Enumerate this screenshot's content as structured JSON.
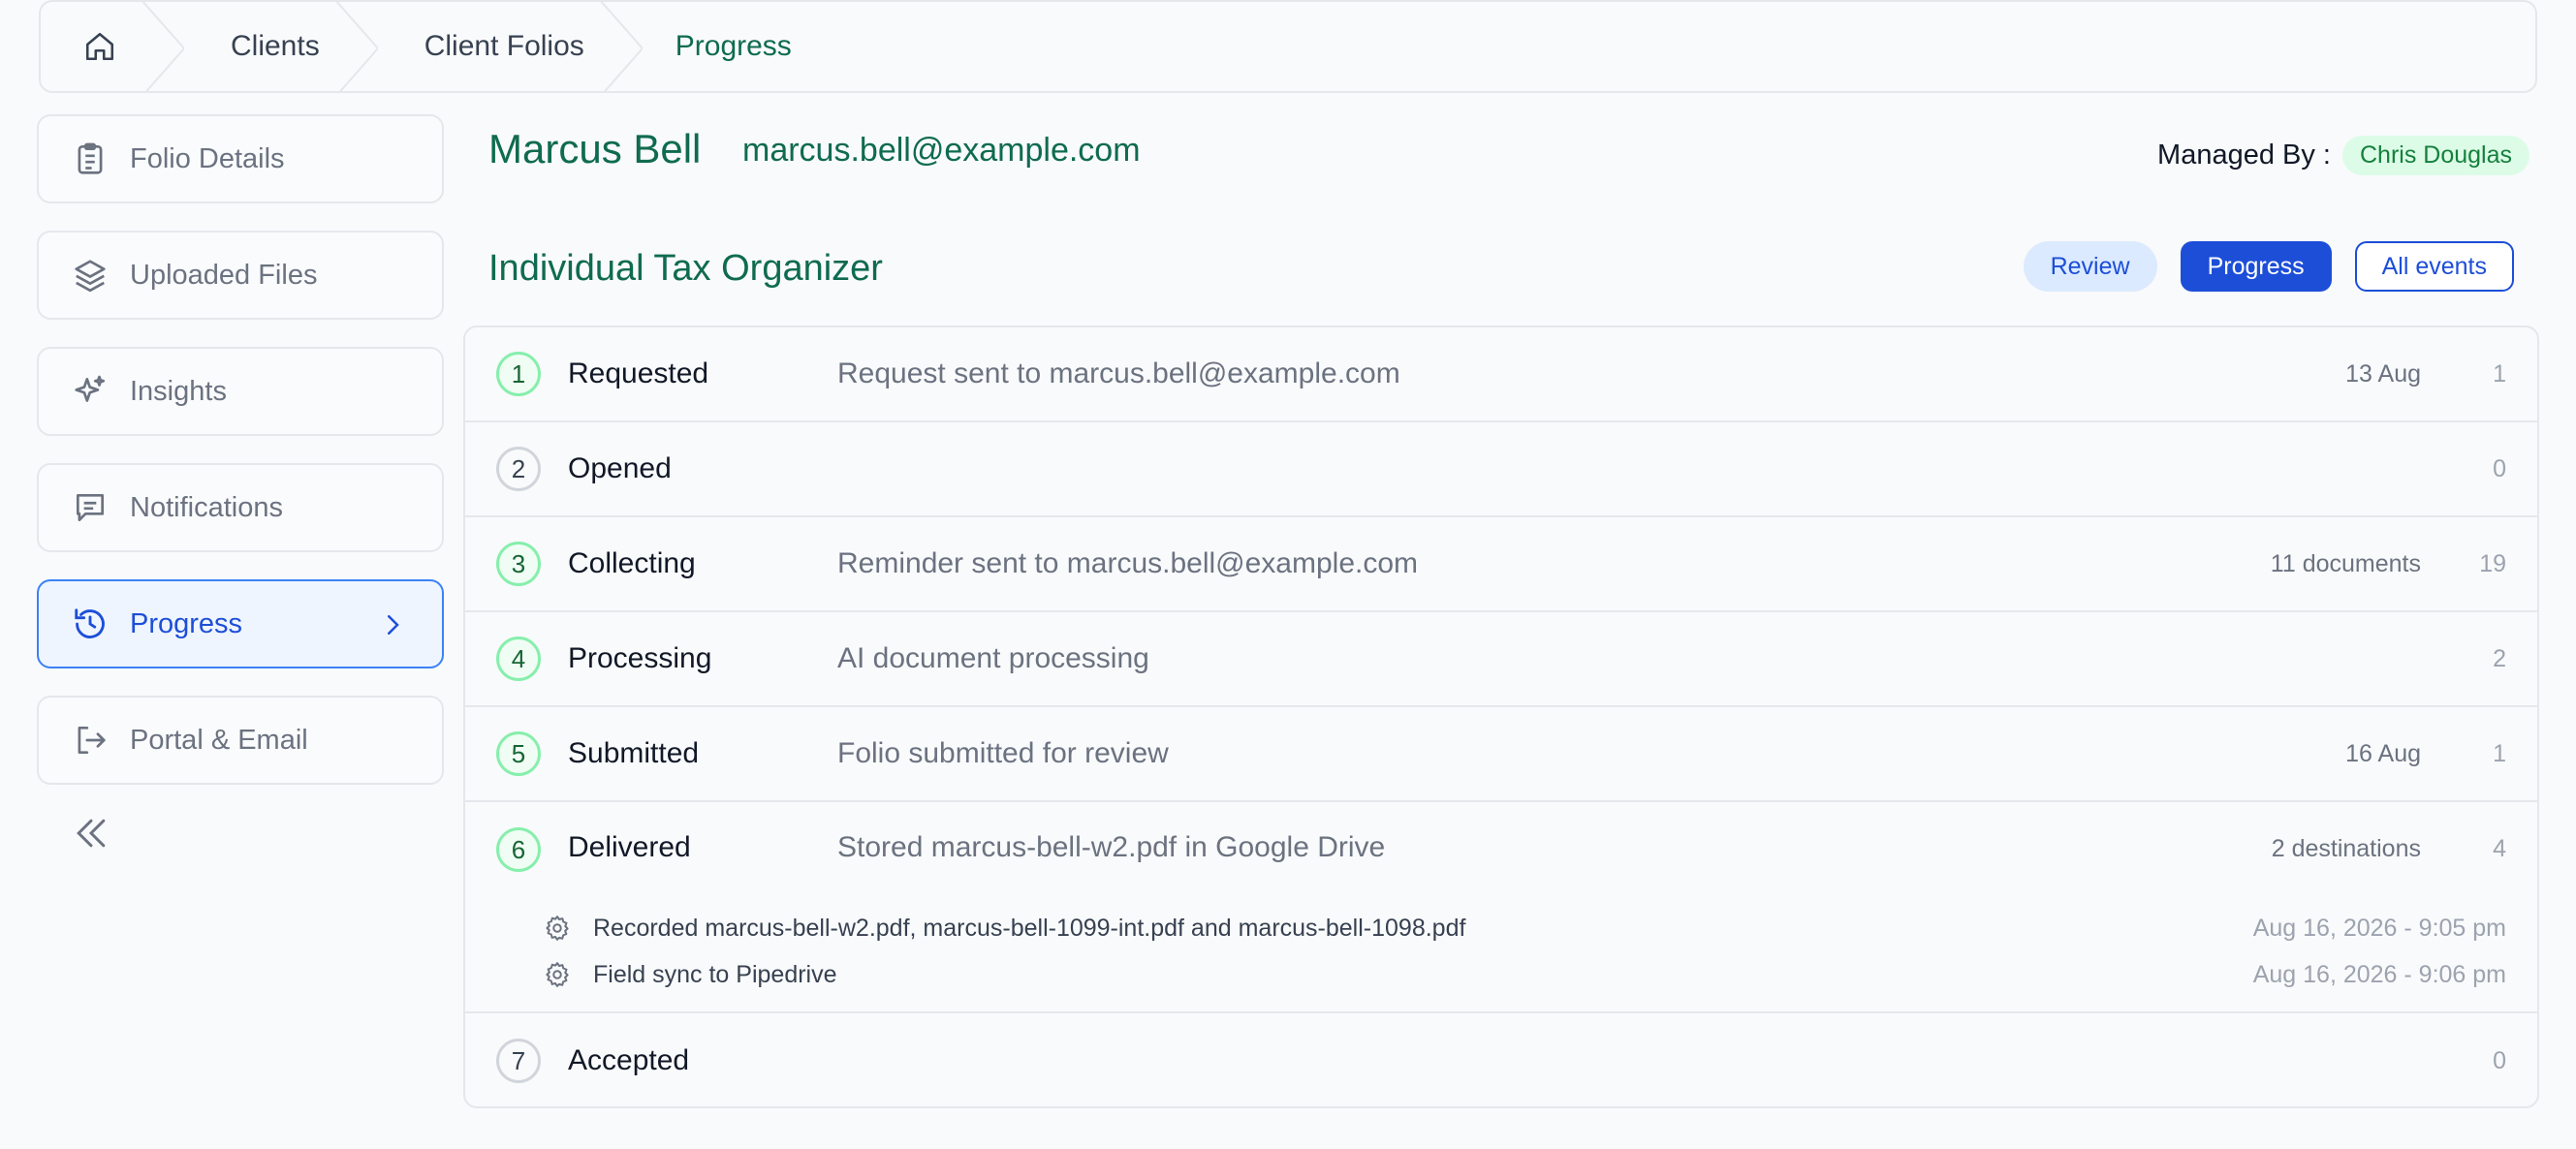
{
  "breadcrumb": {
    "items": [
      "Clients",
      "Client Folios"
    ],
    "current": "Progress"
  },
  "sidebar": {
    "items": [
      {
        "label": "Folio Details",
        "icon": "clipboard-icon"
      },
      {
        "label": "Uploaded Files",
        "icon": "layers-icon"
      },
      {
        "label": "Insights",
        "icon": "sparkles-icon"
      },
      {
        "label": "Notifications",
        "icon": "message-icon"
      },
      {
        "label": "Progress",
        "icon": "history-icon",
        "active": true
      },
      {
        "label": "Portal & Email",
        "icon": "logout-icon"
      }
    ]
  },
  "client": {
    "name": "Marcus Bell",
    "email": "marcus.bell@example.com"
  },
  "managed": {
    "label": "Managed By :",
    "name": "Chris Douglas"
  },
  "organizer": {
    "title": "Individual Tax Organizer"
  },
  "tabs": {
    "review": "Review",
    "progress": "Progress",
    "all": "All events"
  },
  "steps": [
    {
      "num": "1",
      "label": "Requested",
      "desc": "Request sent to marcus.bell@example.com",
      "meta": "13 Aug",
      "count": "1",
      "done": true
    },
    {
      "num": "2",
      "label": "Opened",
      "desc": "",
      "meta": "",
      "count": "0",
      "done": false
    },
    {
      "num": "3",
      "label": "Collecting",
      "desc": "Reminder sent to marcus.bell@example.com",
      "meta": "11 documents",
      "count": "19",
      "done": true
    },
    {
      "num": "4",
      "label": "Processing",
      "desc": "AI document processing",
      "meta": "",
      "count": "2",
      "done": true
    },
    {
      "num": "5",
      "label": "Submitted",
      "desc": "Folio submitted for review",
      "meta": "16 Aug",
      "count": "1",
      "done": true
    },
    {
      "num": "6",
      "label": "Delivered",
      "desc": "Stored marcus-bell-w2.pdf in Google Drive",
      "meta": "2 destinations",
      "count": "4",
      "done": true,
      "events": [
        {
          "text": "Recorded marcus-bell-w2.pdf, marcus-bell-1099-int.pdf and marcus-bell-1098.pdf",
          "time": "Aug 16, 2026 - 9:05 pm"
        },
        {
          "text": "Field sync to Pipedrive",
          "time": "Aug 16, 2026 - 9:06 pm"
        }
      ]
    },
    {
      "num": "7",
      "label": "Accepted",
      "desc": "",
      "meta": "",
      "count": "0",
      "done": false
    }
  ],
  "colors": {
    "accent_green": "#0f6b4f",
    "accent_blue": "#1d4ed8",
    "badge_green_bg": "#dcfce7"
  }
}
